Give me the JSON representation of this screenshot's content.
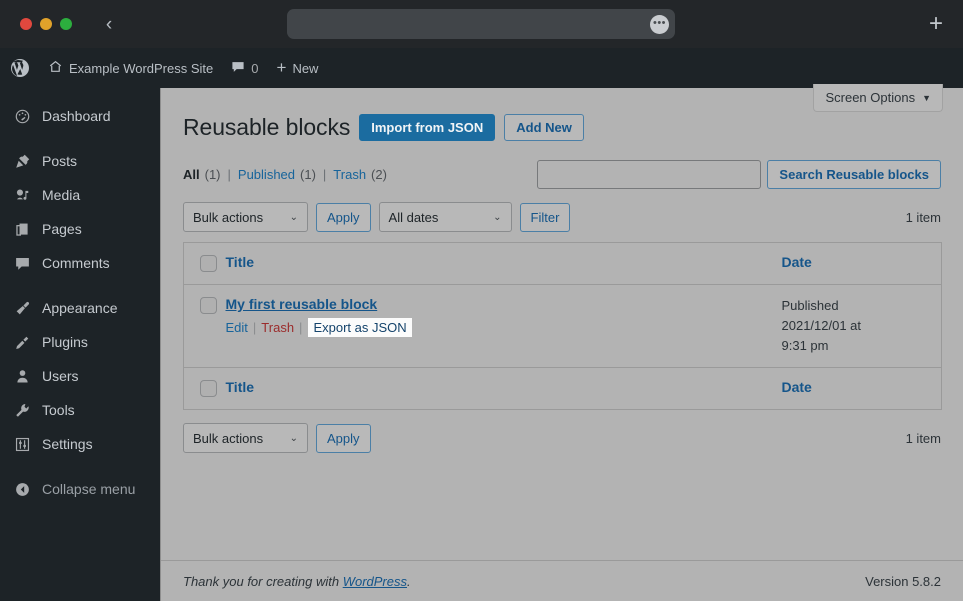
{
  "browser": {
    "url_value": "",
    "url_placeholder": "",
    "menu_icon": "•••",
    "back_icon": "‹",
    "new_tab_icon": "+"
  },
  "adminbar": {
    "site_name": "Example WordPress Site",
    "comment_count": "0",
    "new_label": "New",
    "plus_icon": "+"
  },
  "sidebar": {
    "items": [
      {
        "label": "Dashboard",
        "icon": "dashboard-icon"
      },
      {
        "label": "Posts",
        "icon": "pin-icon"
      },
      {
        "label": "Media",
        "icon": "media-icon"
      },
      {
        "label": "Pages",
        "icon": "pages-icon"
      },
      {
        "label": "Comments",
        "icon": "comment-icon"
      },
      {
        "label": "Appearance",
        "icon": "brush-icon"
      },
      {
        "label": "Plugins",
        "icon": "plug-icon"
      },
      {
        "label": "Users",
        "icon": "user-icon"
      },
      {
        "label": "Tools",
        "icon": "wrench-icon"
      },
      {
        "label": "Settings",
        "icon": "sliders-icon"
      },
      {
        "label": "Collapse menu",
        "icon": "collapse-icon"
      }
    ]
  },
  "screen_options": {
    "label": "Screen Options",
    "caret": "▼"
  },
  "page": {
    "title": "Reusable blocks",
    "import_button": "Import from JSON",
    "add_new_button": "Add New"
  },
  "status_filters": {
    "items": [
      {
        "label": "All",
        "count": "(1)",
        "current": true
      },
      {
        "label": "Published",
        "count": "(1)",
        "current": false
      },
      {
        "label": "Trash",
        "count": "(2)",
        "current": false
      }
    ],
    "separator": "|"
  },
  "search": {
    "value": "",
    "placeholder": "",
    "button_label": "Search Reusable blocks"
  },
  "tablenav_top": {
    "bulk_actions_label": "Bulk actions",
    "apply_label": "Apply",
    "dates_label": "All dates",
    "filter_label": "Filter",
    "items_count": "1 item",
    "caret": "⌄"
  },
  "tablenav_bottom": {
    "bulk_actions_label": "Bulk actions",
    "apply_label": "Apply",
    "items_count": "1 item",
    "caret": "⌄"
  },
  "table": {
    "columns": {
      "title": "Title",
      "date": "Date"
    },
    "rows": [
      {
        "title": "My first reusable block",
        "actions": {
          "edit": "Edit",
          "trash": "Trash",
          "export": "Export as JSON"
        },
        "date_status": "Published",
        "date_value": "2021/12/01 at",
        "date_time": "9:31 pm"
      }
    ]
  },
  "footer": {
    "thanks_prefix": "Thank you for creating with ",
    "wordpress_link": "WordPress",
    "thanks_suffix": ".",
    "version": "Version 5.8.2"
  },
  "colors": {
    "wp_blue": "#1b6ca0",
    "link_blue": "#17649b",
    "trash_red": "#9b2c2c",
    "admin_dark": "#1d2327",
    "content_bg": "#b3b3b3"
  }
}
